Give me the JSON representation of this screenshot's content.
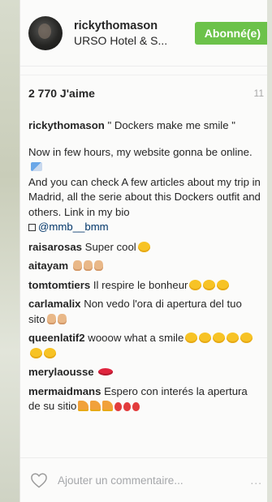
{
  "header": {
    "username": "rickythomason",
    "location": "URSO Hotel & S...",
    "follow_label": "Abonné(e)"
  },
  "stats": {
    "likes": "2 770 J'aime",
    "time": "11"
  },
  "caption": {
    "user": "rickythomason",
    "text_1": "\" Dockers make me smile \"",
    "text_2": "Now in few hours, my website gonna be online.",
    "text_3": "And you can check A few articles about my trip in Madrid, all the serie about this Dockers outfit and others. Link in my bio",
    "mention": "@mmb__bmm"
  },
  "comments": [
    {
      "user": "raisarosas",
      "text": "Super cool",
      "emojis": [
        "grin"
      ]
    },
    {
      "user": "aitayam",
      "text": "",
      "emojis": [
        "hand",
        "hand",
        "hand"
      ]
    },
    {
      "user": "tomtomtiers",
      "text": "Il respire le bonheur",
      "emojis": [
        "grin",
        "grin",
        "grin"
      ]
    },
    {
      "user": "carlamalix",
      "text": "Non vedo l'ora di apertura del tuo sito",
      "emojis": [
        "hand",
        "hand"
      ]
    },
    {
      "user": "queenlatif2",
      "text": "wooow what a smile",
      "emojis": [
        "grin",
        "grin",
        "grin",
        "grin",
        "grin",
        "grin",
        "grin"
      ]
    },
    {
      "user": "merylaousse",
      "text": "",
      "emojis": [
        "lips"
      ]
    },
    {
      "user": "mermaidmans",
      "text": "Espero con interés la apertura de su sitio",
      "emojis": [
        "party",
        "party",
        "party",
        "balloon",
        "balloon",
        "balloon"
      ]
    }
  ],
  "footer": {
    "comment_placeholder": "Ajouter un commentaire...",
    "more_label": "..."
  },
  "colors": {
    "follow_green": "#6cc24a",
    "link_blue": "#003569"
  },
  "icons": {
    "like": "heart-outline-icon",
    "tag": "tag-icon",
    "box": "square-icon"
  }
}
